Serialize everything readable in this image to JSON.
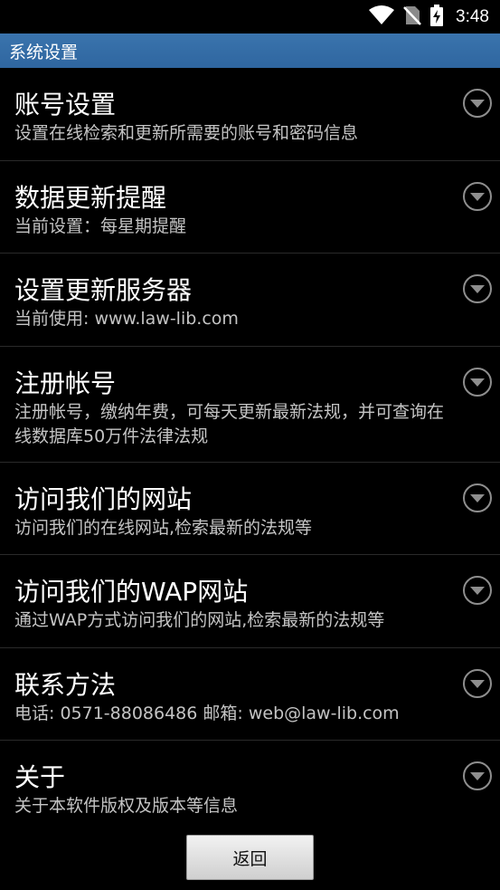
{
  "status_bar": {
    "time": "3:48",
    "icons": [
      "wifi-icon",
      "no-sim-icon",
      "battery-charging-icon"
    ]
  },
  "title_bar": {
    "title": "系统设置",
    "color": "#3a74ad"
  },
  "settings": [
    {
      "title": "账号设置",
      "summary": "设置在线检索和更新所需要的账号和密码信息"
    },
    {
      "title": "数据更新提醒",
      "summary": "当前设置：每星期提醒"
    },
    {
      "title": "设置更新服务器",
      "summary": "当前使用: www.law-lib.com"
    },
    {
      "title": "注册帐号",
      "summary": "注册帐号，缴纳年费，可每天更新最新法规，并可查询在线数据库50万件法律法规"
    },
    {
      "title": "访问我们的网站",
      "summary": "访问我们的在线网站,检索最新的法规等"
    },
    {
      "title": "访问我们的WAP网站",
      "summary": "通过WAP方式访问我们的网站,检索最新的法规等"
    },
    {
      "title": "联系方法",
      "summary": "电话: 0571-88086486 邮箱: web@law-lib.com"
    },
    {
      "title": "关于",
      "summary": "关于本软件版权及版本等信息"
    }
  ],
  "back_button": {
    "label": "返回"
  }
}
